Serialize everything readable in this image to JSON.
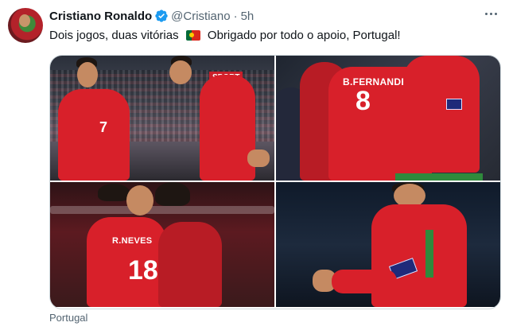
{
  "tweet": {
    "author_name": "Cristiano Ronaldo",
    "handle": "@Cristiano",
    "separator": "·",
    "time": "5h",
    "text_before_flag": "Dois jogos, duas vitórias",
    "text_after_flag": "Obrigado por todo o apoio, Portugal!",
    "flag_icon": "portugal-flag-icon",
    "location": "Portugal"
  },
  "photos": {
    "p1": {
      "number": "7",
      "banner": "SPORT"
    },
    "p2": {
      "name": "B.FERNANDES",
      "number": "8"
    },
    "p3": {
      "name": "R.NEVES",
      "number": "18"
    },
    "p4": {
      "armband": ""
    }
  },
  "colors": {
    "verified_blue": "#1d9bf0",
    "text_secondary": "#536471",
    "portugal_red": "#d8202a",
    "portugal_green": "#046a38"
  }
}
